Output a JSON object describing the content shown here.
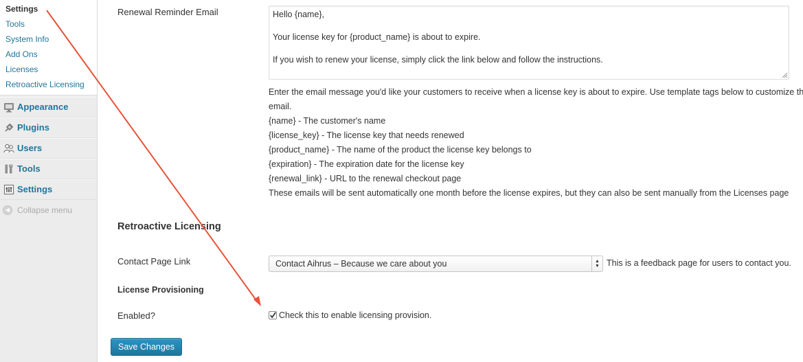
{
  "sidebar": {
    "submenu": [
      {
        "label": "Settings",
        "current": true
      },
      {
        "label": "Tools"
      },
      {
        "label": "System Info"
      },
      {
        "label": "Add Ons"
      },
      {
        "label": "Licenses"
      },
      {
        "label": "Retroactive Licensing"
      }
    ],
    "menu": [
      {
        "label": "Appearance",
        "icon": "appearance-icon"
      },
      {
        "label": "Plugins",
        "icon": "plugins-icon"
      },
      {
        "label": "Users",
        "icon": "users-icon"
      },
      {
        "label": "Tools",
        "icon": "tools-icon"
      },
      {
        "label": "Settings",
        "icon": "settings-icon"
      }
    ],
    "collapse_label": "Collapse menu"
  },
  "renewal": {
    "label": "Renewal Reminder Email",
    "email_lines": [
      "Hello {name},",
      "",
      "Your license key for {product_name} is about to expire.",
      "",
      "If you wish to renew your license, simply click the link below and follow the instructions."
    ],
    "description": [
      "Enter the email message you'd like your customers to receive when a license key is about to expire. Use template tags below to customize the",
      "email.",
      "{name} - The customer's name",
      "{license_key} - The license key that needs renewed",
      "{product_name} - The name of the product the license key belongs to",
      "{expiration} - The expiration date for the license key",
      "{renewal_link} - URL to the renewal checkout page",
      "These emails will be sent automatically one month before the license expires, but they can also be sent manually from the Licenses page"
    ]
  },
  "retroactive": {
    "heading": "Retroactive Licensing",
    "contact_label": "Contact Page Link",
    "contact_selected": "Contact Aihrus – Because we care about you",
    "contact_hint": "This is a feedback page for users to contact you.",
    "provisioning_heading": "License Provisioning",
    "enabled_label": "Enabled?",
    "enabled_checked": true,
    "enabled_text": "Check this to enable licensing provision."
  },
  "save_label": "Save Changes",
  "colors": {
    "link": "#21759b",
    "arrow": "#e8533a",
    "button": "#21759b",
    "sidebar_bg": "#ececec"
  }
}
